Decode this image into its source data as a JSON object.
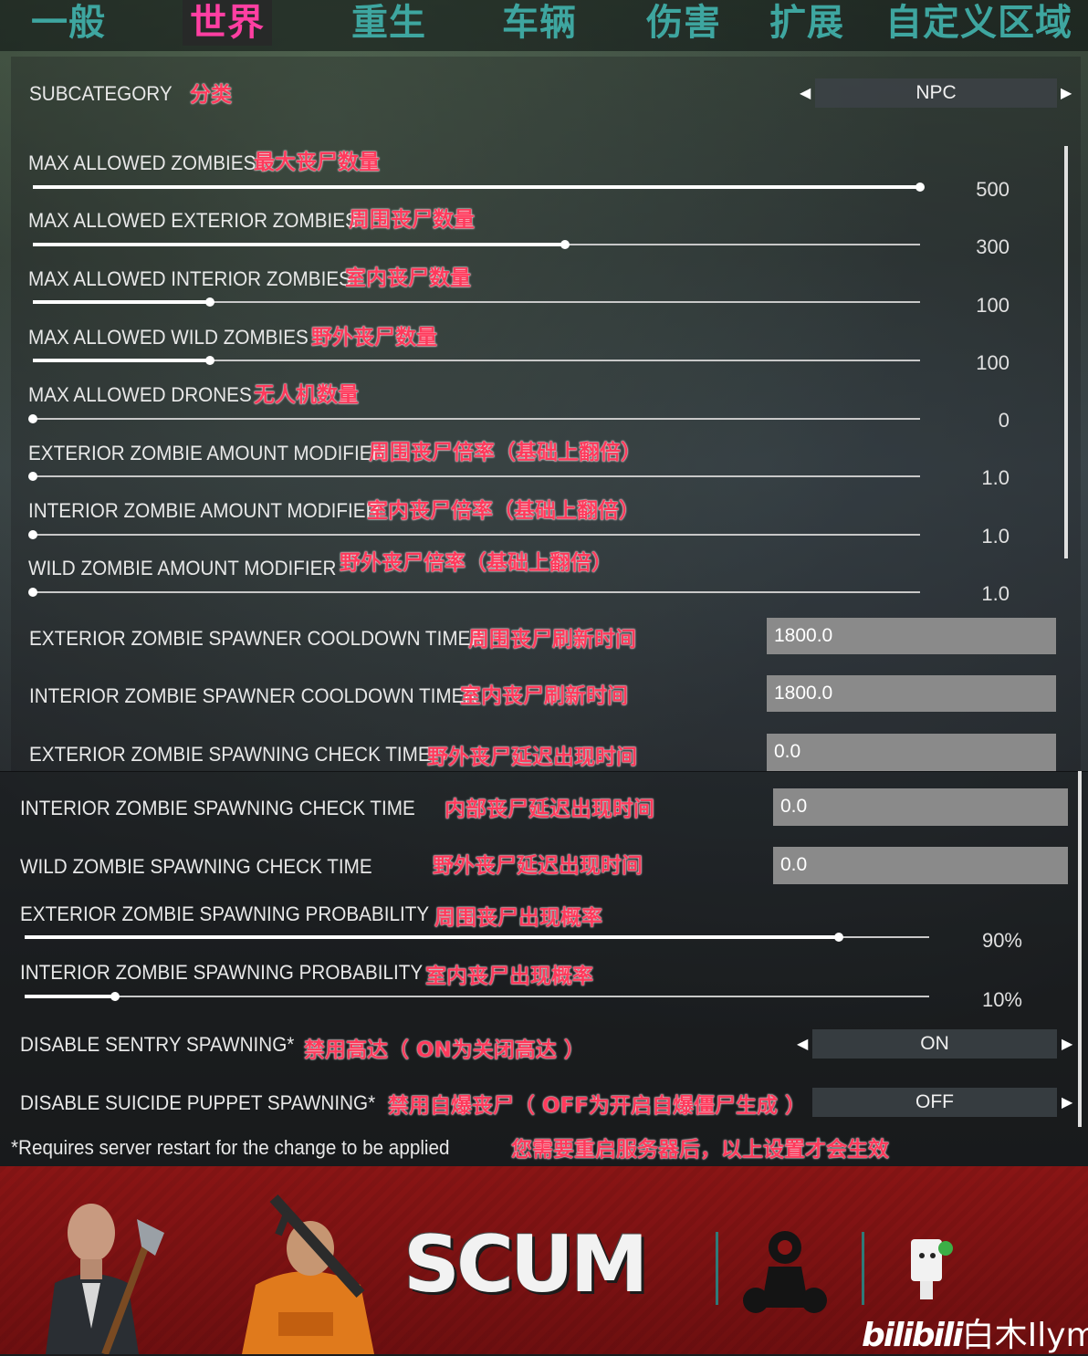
{
  "tabs": [
    {
      "label": "一般",
      "active": false
    },
    {
      "label": "世界",
      "active": true
    },
    {
      "label": "重生",
      "active": false
    },
    {
      "label": "车辆",
      "active": false
    },
    {
      "label": "伤害",
      "active": false
    },
    {
      "label": "扩展",
      "active": false
    },
    {
      "label": "自定义区域",
      "active": false
    }
  ],
  "subcategory": {
    "label": "SUBCATEGORY",
    "note": "分类",
    "value": "NPC"
  },
  "sliders": [
    {
      "label": "MAX ALLOWED ZOMBIES",
      "note": "最大丧尸数量",
      "value": "500",
      "level": 1.0
    },
    {
      "label": "MAX ALLOWED EXTERIOR ZOMBIES",
      "note": "周围丧尸数量",
      "value": "300",
      "level": 0.6
    },
    {
      "label": "MAX ALLOWED INTERIOR ZOMBIES",
      "note": "室内丧尸数量",
      "value": "100",
      "level": 0.2
    },
    {
      "label": "MAX ALLOWED WILD ZOMBIES",
      "note": "野外丧尸数量",
      "value": "100",
      "level": 0.2
    },
    {
      "label": "MAX ALLOWED DRONES",
      "note": "无人机数量",
      "value": "0",
      "level": 0.0
    },
    {
      "label": "EXTERIOR ZOMBIE AMOUNT MODIFIER",
      "note": "周围丧尸倍率（基础上翻倍）",
      "value": "1.0",
      "level": 0.0
    },
    {
      "label": "INTERIOR ZOMBIE AMOUNT MODIFIER",
      "note": "室内丧尸倍率（基础上翻倍）",
      "value": "1.0",
      "level": 0.0
    },
    {
      "label": "WILD ZOMBIE AMOUNT MODIFIER",
      "note": "野外丧尸倍率（基础上翻倍）",
      "value": "1.0",
      "level": 0.0
    }
  ],
  "fields_top": [
    {
      "label": "EXTERIOR ZOMBIE SPAWNER COOLDOWN TIMER",
      "note": "周围丧尸刷新时间",
      "value": "1800.0"
    },
    {
      "label": "INTERIOR ZOMBIE SPAWNER COOLDOWN TIMER",
      "note": "室内丧尸刷新时间",
      "value": "1800.0"
    },
    {
      "label": "EXTERIOR ZOMBIE SPAWNING CHECK TIME",
      "note": "野外丧尸延迟出现时间",
      "value": "0.0"
    }
  ],
  "fields_bottom": [
    {
      "label": "INTERIOR ZOMBIE SPAWNING CHECK TIME",
      "note": "内部丧尸延迟出现时间",
      "value": "0.0"
    },
    {
      "label": "WILD ZOMBIE SPAWNING CHECK TIME",
      "note": "野外丧尸延迟出现时间",
      "value": "0.0"
    }
  ],
  "probabilities": [
    {
      "label": "EXTERIOR ZOMBIE SPAWNING PROBABILITY",
      "note": "周围丧尸出现概率",
      "value": "90%",
      "level": 0.9
    },
    {
      "label": "INTERIOR ZOMBIE SPAWNING PROBABILITY",
      "note": "室内丧尸出现概率",
      "value": "10%",
      "level": 0.1
    }
  ],
  "toggles": [
    {
      "label": "DISABLE SENTRY SPAWNING*",
      "note": "禁用高达（ ON为关闭高达 ）",
      "value": "ON"
    },
    {
      "label": "DISABLE SUICIDE PUPPET SPAWNING*",
      "note": "禁用自爆丧尸（ OFF为开启自爆僵尸生成 ）",
      "value": "OFF"
    }
  ],
  "footnote": {
    "text": "*Requires server restart for the change to be applied",
    "note": "您需要重启服务器后，以上设置才会生效"
  },
  "banner": {
    "logo": "SCUM",
    "watermark_brand": "bilibili",
    "watermark_user": "白木Ilym"
  },
  "icons": {
    "left": "◀",
    "right": "▶"
  },
  "colors": {
    "tab": "#3ea6a0",
    "tab_active": "#ff3fa2",
    "note": "#ff3a5c",
    "banner": "#7f1213"
  }
}
